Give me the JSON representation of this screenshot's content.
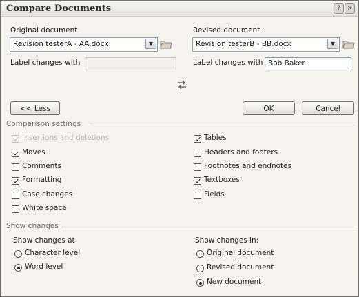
{
  "window": {
    "title": "Compare Documents",
    "help_glyph": "?",
    "close_glyph": "×"
  },
  "original": {
    "heading": "Original document",
    "file": "Revision testerA - AA.docx",
    "label_changes": "Label changes with",
    "label_value": ""
  },
  "revised": {
    "heading": "Revised document",
    "file": "Revision testerB - BB.docx",
    "label_changes": "Label changes with",
    "label_value": "Bob Baker"
  },
  "buttons": {
    "less": "<< Less",
    "ok": "OK",
    "cancel": "Cancel"
  },
  "comparison": {
    "title": "Comparison settings",
    "left": [
      {
        "label": "Insertions and deletions",
        "checked": true,
        "disabled": true
      },
      {
        "label": "Moves",
        "checked": true
      },
      {
        "label": "Comments",
        "checked": false
      },
      {
        "label": "Formatting",
        "checked": true
      },
      {
        "label": "Case changes",
        "checked": false
      },
      {
        "label": "White space",
        "checked": false
      }
    ],
    "right": [
      {
        "label": "Tables",
        "checked": true
      },
      {
        "label": "Headers and footers",
        "checked": false
      },
      {
        "label": "Footnotes and endnotes",
        "checked": false
      },
      {
        "label": "Textboxes",
        "checked": true
      },
      {
        "label": "Fields",
        "checked": false
      }
    ]
  },
  "show_changes": {
    "title": "Show changes",
    "at_label": "Show changes at:",
    "at_options": [
      {
        "label": "Character level",
        "selected": false
      },
      {
        "label": "Word level",
        "selected": true
      }
    ],
    "in_label": "Show changes in:",
    "in_options": [
      {
        "label": "Original document",
        "selected": false
      },
      {
        "label": "Revised document",
        "selected": false
      },
      {
        "label": "New document",
        "selected": true
      }
    ]
  }
}
